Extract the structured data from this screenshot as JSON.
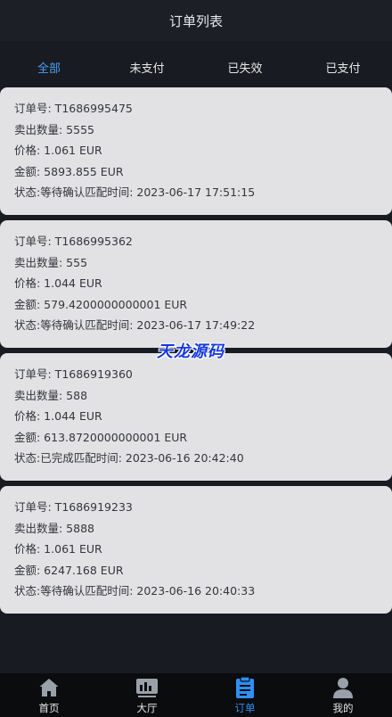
{
  "header": {
    "title": "订单列表"
  },
  "tabs": [
    {
      "label": "全部"
    },
    {
      "label": "未支付"
    },
    {
      "label": "已失效"
    },
    {
      "label": "已支付"
    }
  ],
  "active_tab": "全部",
  "orders": [
    {
      "order_no": "订单号: T1686995475",
      "quantity": "卖出数量: 5555",
      "price": "价格: 1.061 EUR",
      "amount": "金额: 5893.855 EUR",
      "status": "状态:等待确认匹配时间: 2023-06-17 17:51:15"
    },
    {
      "order_no": "订单号: T1686995362",
      "quantity": "卖出数量: 555",
      "price": "价格: 1.044 EUR",
      "amount": "金额: 579.4200000000001 EUR",
      "status": "状态:等待确认匹配时间: 2023-06-17 17:49:22"
    },
    {
      "order_no": "订单号: T1686919360",
      "quantity": "卖出数量: 588",
      "price": "价格: 1.044 EUR",
      "amount": "金额: 613.8720000000001 EUR",
      "status": "状态:已完成匹配时间: 2023-06-16 20:42:40"
    },
    {
      "order_no": "订单号: T1686919233",
      "quantity": "卖出数量: 5888",
      "price": "价格: 1.061 EUR",
      "amount": "金额: 6247.168 EUR",
      "status": "状态:等待确认匹配时间: 2023-06-16 20:40:33"
    }
  ],
  "watermark": "天龙源码",
  "bottom_nav": [
    {
      "label": "首页",
      "icon": "home-icon"
    },
    {
      "label": "大厅",
      "icon": "chart-icon"
    },
    {
      "label": "订单",
      "icon": "clipboard-icon"
    },
    {
      "label": "我的",
      "icon": "user-icon"
    }
  ],
  "active_nav": "订单",
  "colors": {
    "background": "#181b21",
    "card": "#e2e2e4",
    "accent": "#2f8ff5",
    "tab_active": "#4d9ef5",
    "watermark": "#1639e0"
  }
}
